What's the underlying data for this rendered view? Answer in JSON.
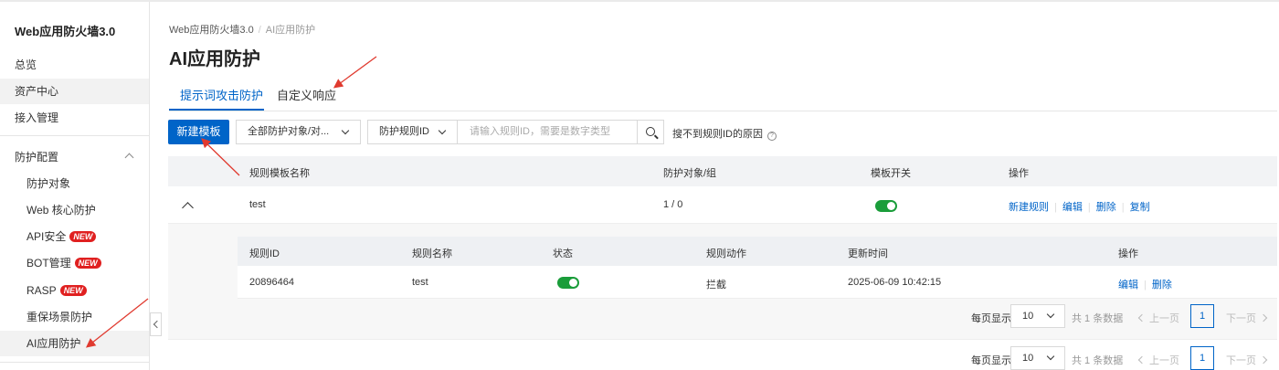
{
  "app": {
    "title": "Web应用防火墙3.0"
  },
  "sidebar": {
    "items": [
      {
        "label": "总览"
      },
      {
        "label": "资产中心"
      },
      {
        "label": "接入管理"
      },
      {
        "label": "防护配置"
      },
      {
        "label": "防护对象"
      },
      {
        "label": "Web 核心防护"
      },
      {
        "label": "API安全",
        "badge": "NEW"
      },
      {
        "label": "BOT管理",
        "badge": "NEW"
      },
      {
        "label": "RASP",
        "badge": "NEW"
      },
      {
        "label": "重保场景防护"
      },
      {
        "label": "AI应用防护"
      }
    ]
  },
  "breadcrumb": {
    "root": "Web应用防火墙3.0",
    "current": "AI应用防护"
  },
  "page": {
    "title": "AI应用防护"
  },
  "tabs": [
    {
      "label": "提示词攻击防护",
      "active": true
    },
    {
      "label": "自定义响应",
      "active": false
    }
  ],
  "toolbar": {
    "new_template": "新建模板",
    "object_filter": "全部防护对象/对...",
    "rule_id_select": "防护规则ID",
    "search_placeholder": "请输入规则ID，需要是数字类型",
    "hint": "搜不到规则ID的原因",
    "help_glyph": "?"
  },
  "table": {
    "headers": [
      "规则模板名称",
      "防护对象/组",
      "模板开关",
      "操作"
    ],
    "rows": [
      {
        "name": "test",
        "objects": "1 / 0",
        "enabled": true,
        "actions": [
          "新建规则",
          "编辑",
          "删除",
          "复制"
        ]
      }
    ]
  },
  "inner_table": {
    "headers": [
      "规则ID",
      "规则名称",
      "状态",
      "规则动作",
      "更新时间",
      "操作"
    ],
    "rows": [
      {
        "id": "20896464",
        "name": "test",
        "enabled": true,
        "action": "拦截",
        "updated": "2025-06-09 10:42:15",
        "actions": [
          "编辑",
          "删除"
        ]
      }
    ]
  },
  "pagination": {
    "per_page_label": "每页显示",
    "per_page": "10",
    "total": "共 1 条数据",
    "prev": "上一页",
    "next": "下一页",
    "page": "1"
  },
  "colors": {
    "accent": "#0064c8",
    "toggle_on": "#1a9d3a",
    "badge": "#e02020",
    "annotation_arrow": "#e03a2f"
  }
}
